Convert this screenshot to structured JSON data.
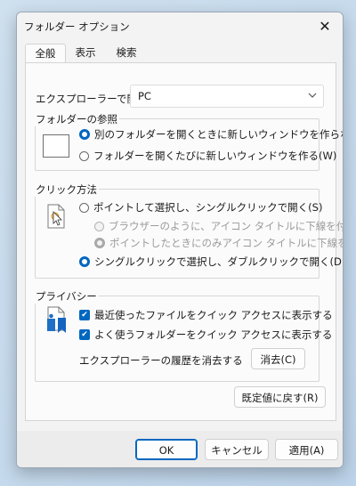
{
  "window": {
    "title": "フォルダー オプション",
    "close_glyph": "✕"
  },
  "tabs": [
    {
      "label": "全般",
      "active": true
    },
    {
      "label": "表示",
      "active": false
    },
    {
      "label": "検索",
      "active": false
    }
  ],
  "general": {
    "open_explorer_label": "エクスプローラーで開く:",
    "open_explorer_value": "PC",
    "browse_folders": {
      "legend": "フォルダーの参照",
      "options": [
        {
          "label": "別のフォルダーを開くときに新しいウィンドウを作らない(M)",
          "selected": true
        },
        {
          "label": "フォルダーを開くたびに新しいウィンドウを作る(W)",
          "selected": false
        }
      ]
    },
    "click_method": {
      "legend": "クリック方法",
      "single_click": "ポイントして選択し、シングルクリックで開く(S)",
      "sub_options": [
        {
          "label": "ブラウザーのように、アイコン タイトルに下線を付ける(B)",
          "selected": false,
          "disabled": true
        },
        {
          "label": "ポイントしたときにのみアイコン タイトルに下線を付ける(",
          "selected": true,
          "disabled": true
        }
      ],
      "double_click": "シングルクリックで選択し、ダブルクリックで開く(D)"
    },
    "privacy": {
      "legend": "プライバシー",
      "checkboxes": [
        {
          "label": "最近使ったファイルをクイック アクセスに表示する",
          "checked": true
        },
        {
          "label": "よく使うフォルダーをクイック アクセスに表示する",
          "checked": true
        }
      ],
      "clear_history_label": "エクスプローラーの履歴を消去する",
      "clear_button": "消去(C)"
    },
    "restore_defaults_button": "既定値に戻す(R)"
  },
  "footer": {
    "ok": "OK",
    "cancel": "キャンセル",
    "apply": "適用(A)"
  },
  "colors": {
    "accent": "#0067c0"
  }
}
